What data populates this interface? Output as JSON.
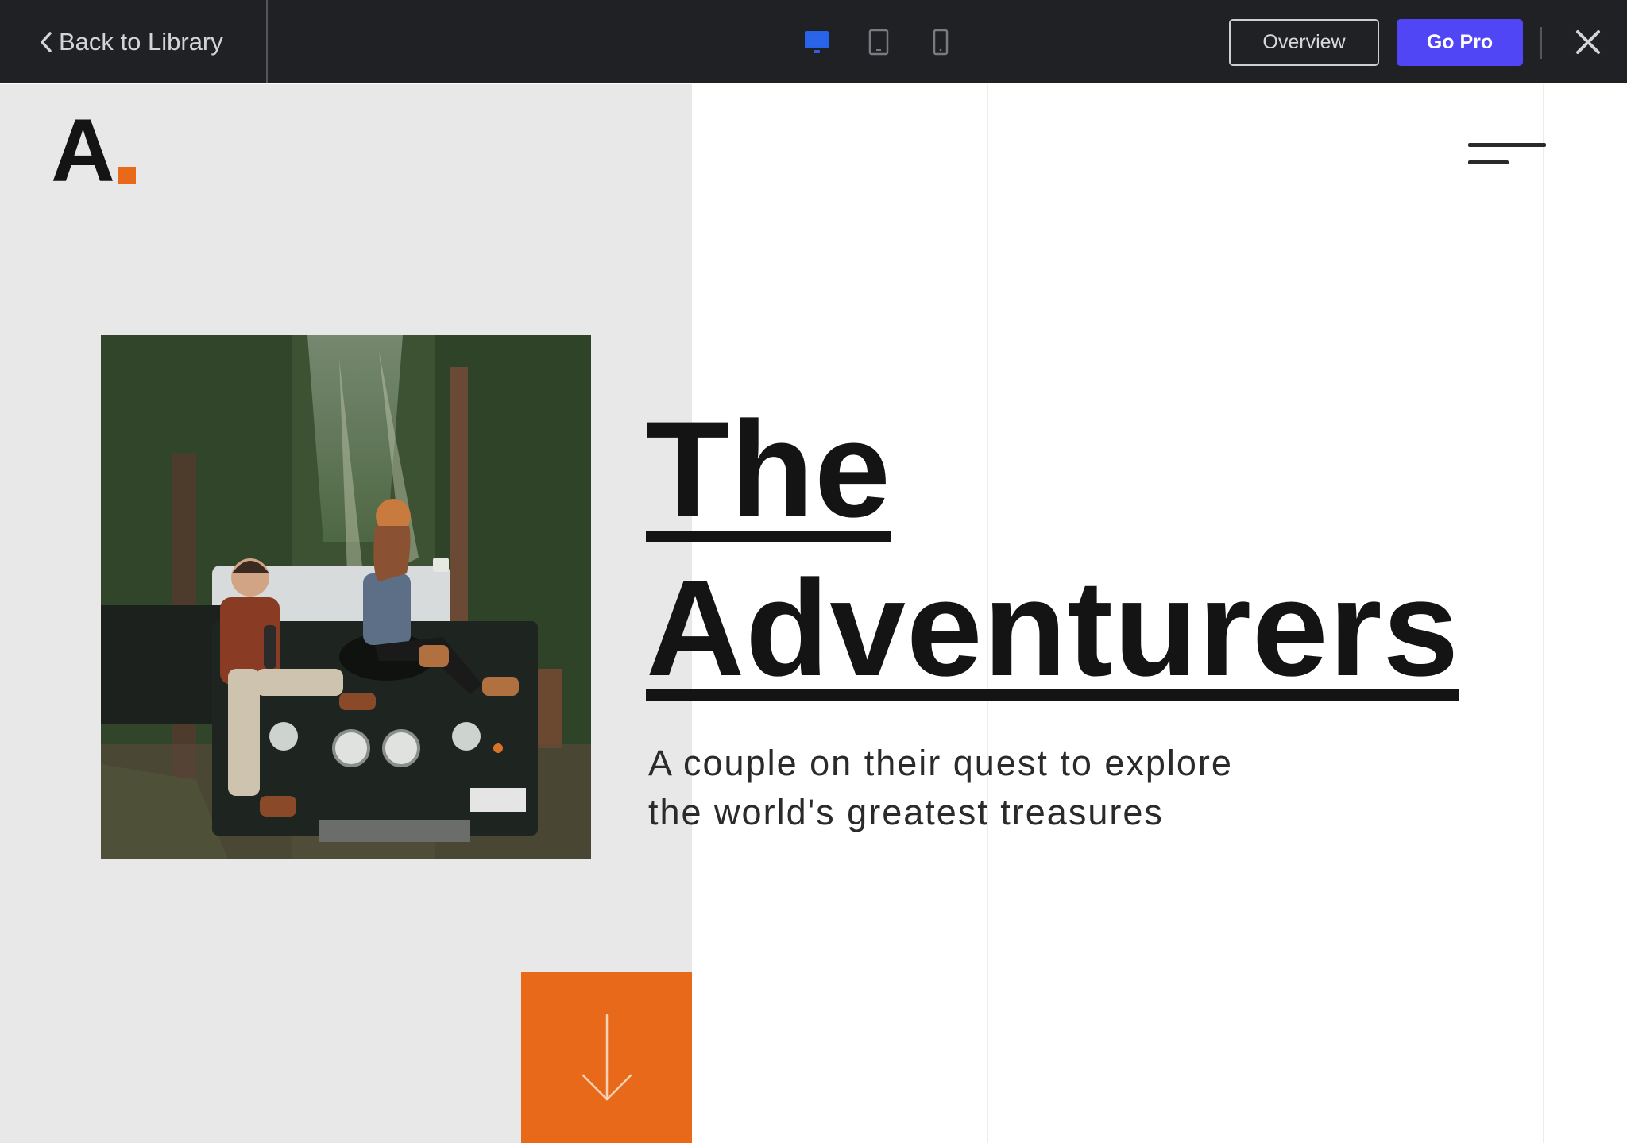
{
  "topbar": {
    "back_label": "Back to Library",
    "devices": [
      {
        "name": "desktop",
        "active": true
      },
      {
        "name": "tablet",
        "active": false
      },
      {
        "name": "mobile",
        "active": false
      }
    ],
    "overview_label": "Overview",
    "gopro_label": "Go Pro",
    "colors": {
      "bar_bg": "#202125",
      "active_device": "#3b82f6",
      "gopro_bg": "#5046f5"
    }
  },
  "site": {
    "logo_letter": "A",
    "accent_color": "#e8691a",
    "hero": {
      "title_line1": "The",
      "title_line2": "Adventurers",
      "subtitle_line1": "A couple on their quest to explore",
      "subtitle_line2": "the world's greatest treasures",
      "image_alt": "Couple sitting on the hood of a dark off-road vehicle in a mossy forest"
    },
    "scroll_icon": "arrow-down-icon",
    "menu_icon": "hamburger-menu-icon"
  }
}
